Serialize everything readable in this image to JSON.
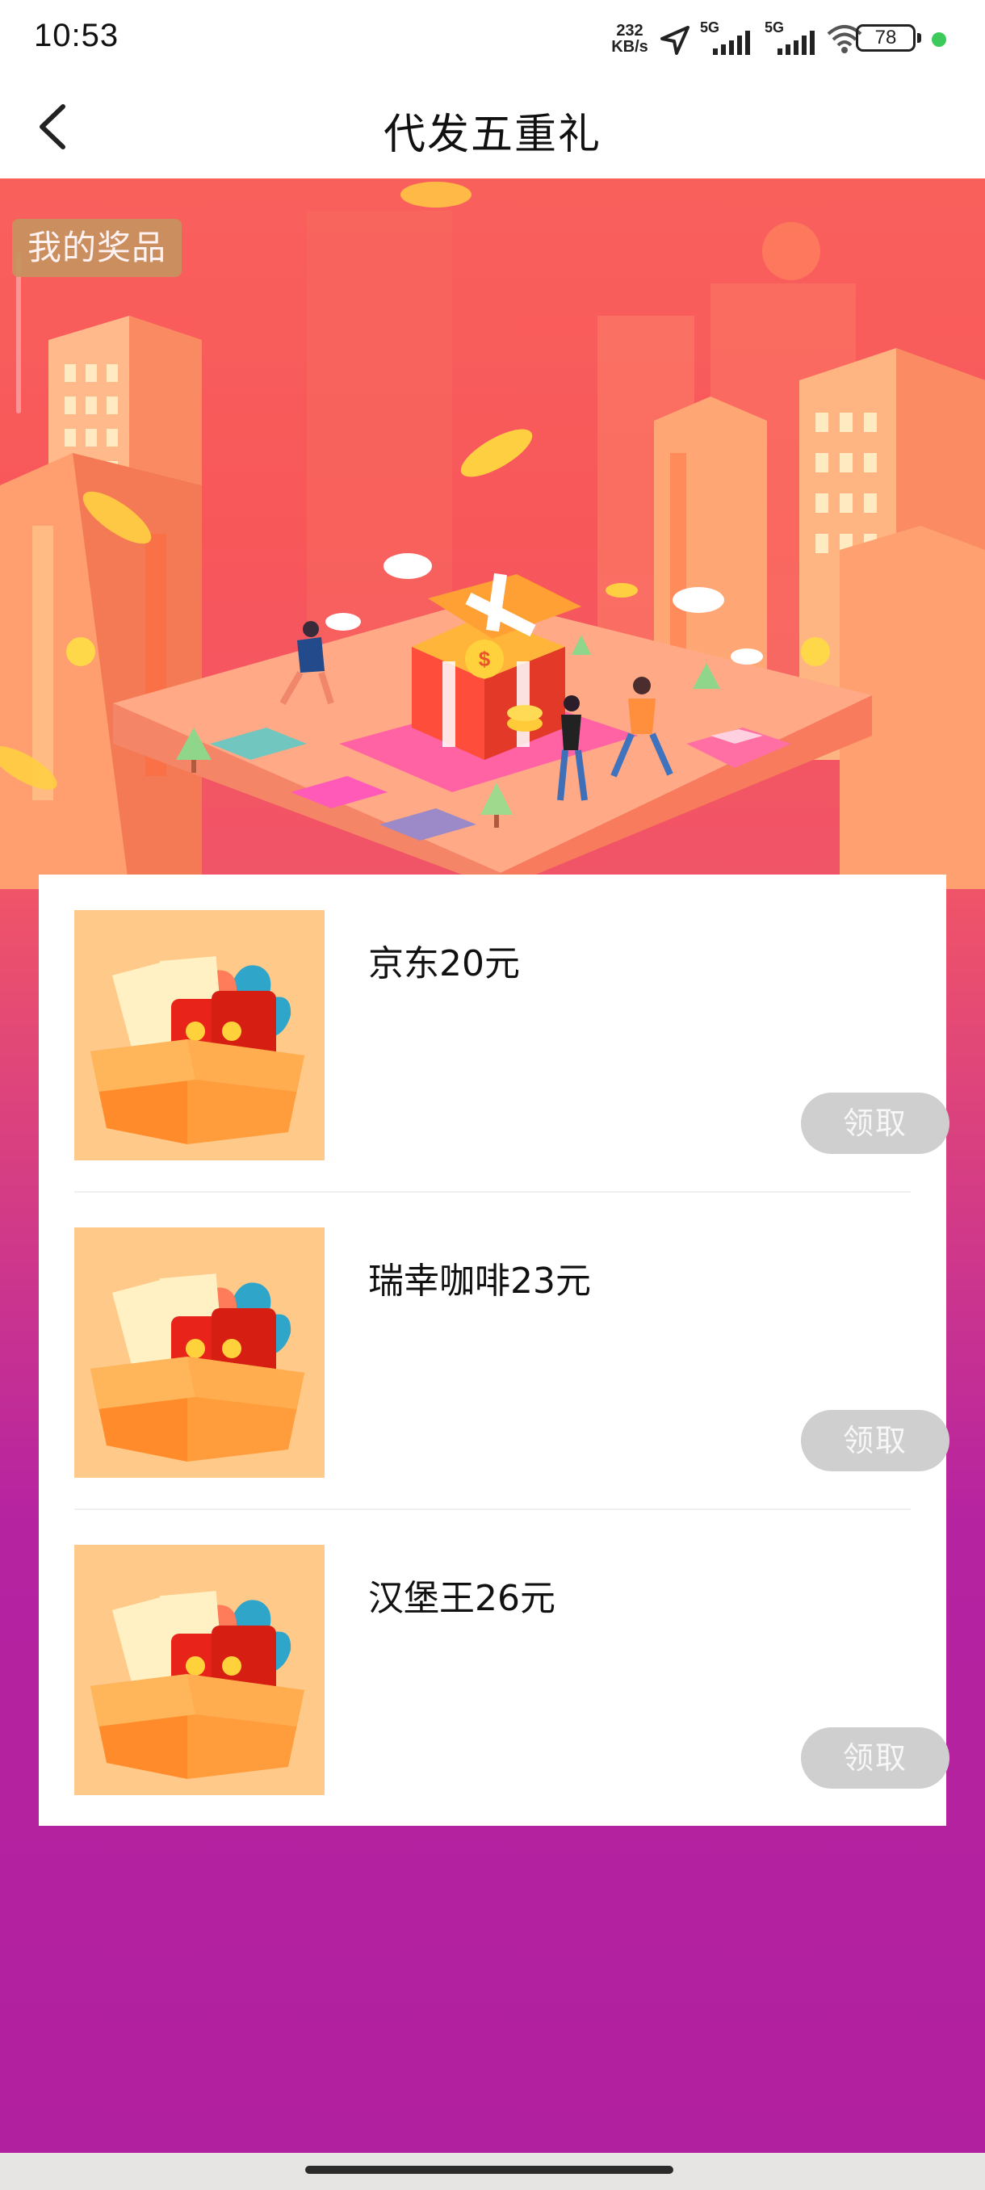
{
  "status_bar": {
    "time": "10:53",
    "net_speed_value": "232",
    "net_speed_unit": "KB/s",
    "network_1": "5G",
    "network_2": "5G",
    "battery": "78"
  },
  "nav": {
    "title": "代发五重礼",
    "back_icon": "chevron-left-icon"
  },
  "hero": {
    "my_prizes_label": "我的奖品"
  },
  "prizes": [
    {
      "name": "京东20元",
      "button_label": "领取",
      "icon": "gift-box-icon"
    },
    {
      "name": "瑞幸咖啡23元",
      "button_label": "领取",
      "icon": "gift-box-icon"
    },
    {
      "name": "汉堡王26元",
      "button_label": "领取",
      "icon": "gift-box-icon"
    }
  ],
  "colors": {
    "hero_top": "#f9605c",
    "hero_bottom": "#b1209f",
    "button_disabled": "#cfcfcf",
    "my_prizes_bg": "#c8935f"
  }
}
